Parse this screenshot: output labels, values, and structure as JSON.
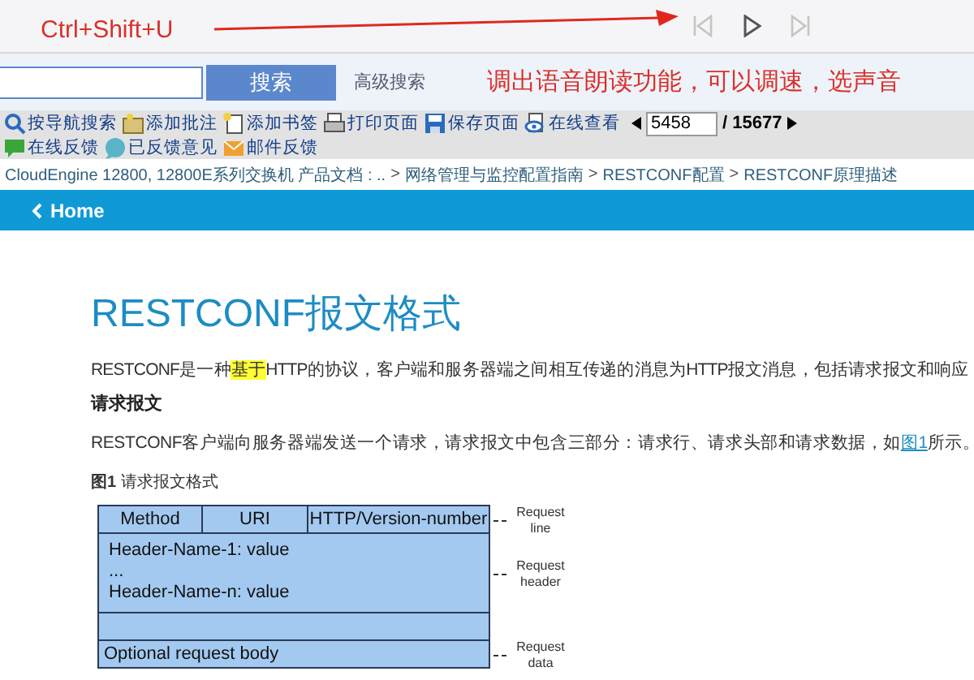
{
  "annotation": {
    "shortcut": "Ctrl+Shift+U",
    "note": "调出语音朗读功能，可以调速，选声音"
  },
  "media_controls": [
    {
      "kind": "previous",
      "disabled": true
    },
    {
      "kind": "play",
      "disabled": false
    },
    {
      "kind": "next",
      "disabled": true
    }
  ],
  "search": {
    "button": "搜索",
    "advanced_link": "高级搜索"
  },
  "toolbar": {
    "items": [
      {
        "kind": "search",
        "label": "按导航搜索"
      },
      {
        "kind": "note",
        "label": "添加批注"
      },
      {
        "kind": "bookmark",
        "label": "添加书签"
      },
      {
        "kind": "print",
        "label": "打印页面"
      },
      {
        "kind": "save",
        "label": "保存页面"
      },
      {
        "kind": "view",
        "label": "在线查看"
      },
      {
        "kind": "feedback",
        "label": "在线反馈"
      },
      {
        "kind": "comments",
        "label": "已反馈意见"
      },
      {
        "kind": "mail",
        "label": "邮件反馈"
      }
    ],
    "page": {
      "value": "5458",
      "total": "/ 15677"
    }
  },
  "breadcrumb": {
    "items": [
      "CloudEngine 12800, 12800E系列交换机 产品文档 : ..",
      "网络管理与监控配置指南",
      "RESTCONF配置",
      "RESTCONF原理描述"
    ],
    "separators": [
      ">",
      ">",
      ">"
    ]
  },
  "nav": {
    "home": "Home"
  },
  "article": {
    "title": "RESTCONF报文格式",
    "intro": [
      {
        "kind": "text",
        "text": "RESTCONF是一种"
      },
      {
        "kind": "highlight",
        "text": "基于"
      },
      {
        "kind": "text",
        "text": "HTTP的协议，客户端和服务器端之间相互传递的消息为HTTP报文消息，包括请求报文和响应"
      }
    ],
    "subheading": "请求报文",
    "paragraph": [
      {
        "kind": "text",
        "text": "RESTCONF客户端向服务器端发送一个请求，请求报文中包含三部分：请求行、请求头部和请求数据，如"
      },
      {
        "kind": "link",
        "text": "图1"
      },
      {
        "kind": "text",
        "text": "所示。"
      }
    ],
    "figure": {
      "caption": "**图1** 请求报文格式",
      "request_line": [
        "Method",
        "URI",
        "HTTP/Version-number"
      ],
      "header_lines": [
        "Header-Name-1: value",
        "...",
        "Header-Name-n: value"
      ],
      "body": "Optional request body",
      "callouts": [
        "Request line",
        "Request header",
        "Request data"
      ]
    }
  }
}
